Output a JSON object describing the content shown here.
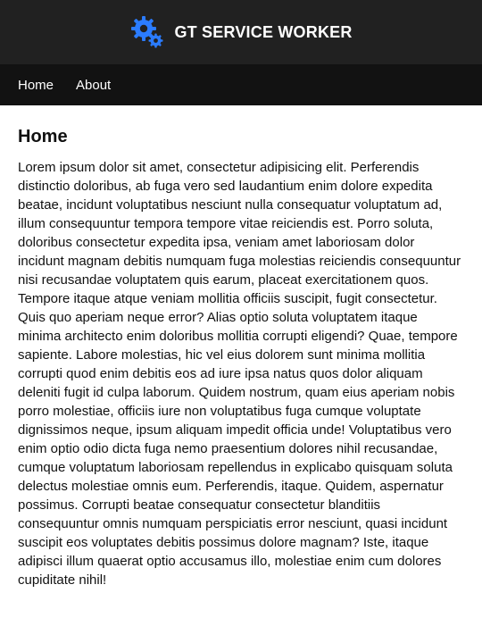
{
  "colors": {
    "header_bg": "#212121",
    "nav_bg": "#121212",
    "logo_blue": "#2b7cff",
    "text": "#111111"
  },
  "header": {
    "logo_icon": "gears-icon",
    "title": "GT SERVICE WORKER"
  },
  "nav": {
    "items": [
      {
        "label": "Home"
      },
      {
        "label": "About"
      }
    ]
  },
  "main": {
    "title": "Home",
    "body": "Lorem ipsum dolor sit amet, consectetur adipisicing elit. Perferendis distinctio doloribus, ab fuga vero sed laudantium enim dolore expedita beatae, incidunt voluptatibus nesciunt nulla consequatur voluptatum ad, illum consequuntur tempora tempore vitae reiciendis est. Porro soluta, doloribus consectetur expedita ipsa, veniam amet laboriosam dolor incidunt magnam debitis numquam fuga molestias reiciendis consequuntur nisi recusandae voluptatem quis earum, placeat exercitationem quos. Tempore itaque atque veniam mollitia officiis suscipit, fugit consectetur. Quis quo aperiam neque error? Alias optio soluta voluptatem itaque minima architecto enim doloribus mollitia corrupti eligendi? Quae, tempore sapiente. Labore molestias, hic vel eius dolorem sunt minima mollitia corrupti quod enim debitis eos ad iure ipsa natus quos dolor aliquam deleniti fugit id culpa laborum. Quidem nostrum, quam eius aperiam nobis porro molestiae, officiis iure non voluptatibus fuga cumque voluptate dignissimos neque, ipsum aliquam impedit officia unde! Voluptatibus vero enim optio odio dicta fuga nemo praesentium dolores nihil recusandae, cumque voluptatum laboriosam repellendus in explicabo quisquam soluta delectus molestiae omnis eum. Perferendis, itaque. Quidem, aspernatur possimus. Corrupti beatae consequatur consectetur blanditiis consequuntur omnis numquam perspiciatis error nesciunt, quasi incidunt suscipit eos voluptates debitis possimus dolore magnam? Iste, itaque adipisci illum quaerat optio accusamus illo, molestiae enim cum dolores cupiditate nihil!"
  }
}
